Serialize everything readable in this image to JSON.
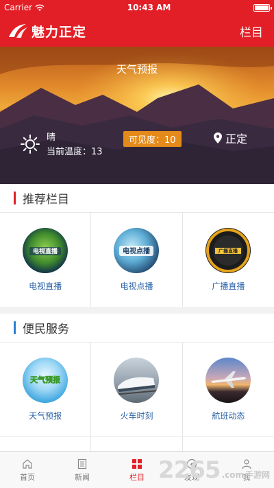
{
  "status_bar": {
    "carrier": "Carrier",
    "time": "10:43 AM",
    "battery_level": 1.0
  },
  "header": {
    "title": "魅力正定",
    "right_label": "栏目"
  },
  "banner": {
    "title": "天气预报",
    "condition": "晴",
    "temperature": "当前温度：13",
    "visibility": "可见度：10",
    "location": "正定"
  },
  "sections": [
    {
      "title": "推荐栏目",
      "bar_color": "#e21f26",
      "items": [
        {
          "label": "电视直播",
          "icon": "tv-live-thumbnail"
        },
        {
          "label": "电视点播",
          "icon": "tv-vod-thumbnail"
        },
        {
          "label": "广播直播",
          "icon": "radio-live-thumbnail"
        }
      ]
    },
    {
      "title": "便民服务",
      "bar_color": "#2c7fd2",
      "items": [
        {
          "label": "天气预报",
          "icon": "weather-thumbnail"
        },
        {
          "label": "火车时刻",
          "icon": "train-thumbnail"
        },
        {
          "label": "航班动态",
          "icon": "airplane-thumbnail"
        }
      ]
    }
  ],
  "tabs": [
    {
      "label": "首页",
      "icon": "home-icon"
    },
    {
      "label": "新闻",
      "icon": "news-icon"
    },
    {
      "label": "栏目",
      "icon": "grid-icon",
      "active": true
    },
    {
      "label": "发现",
      "icon": "compass-icon"
    },
    {
      "label": "我",
      "icon": "user-icon"
    }
  ],
  "watermark": {
    "number": "2265",
    "suffix": ".com",
    "text": "手游网"
  },
  "colors": {
    "brand_red": "#e21f26",
    "link_blue": "#2c63a8",
    "visibility_orange": "#e48a1b"
  }
}
